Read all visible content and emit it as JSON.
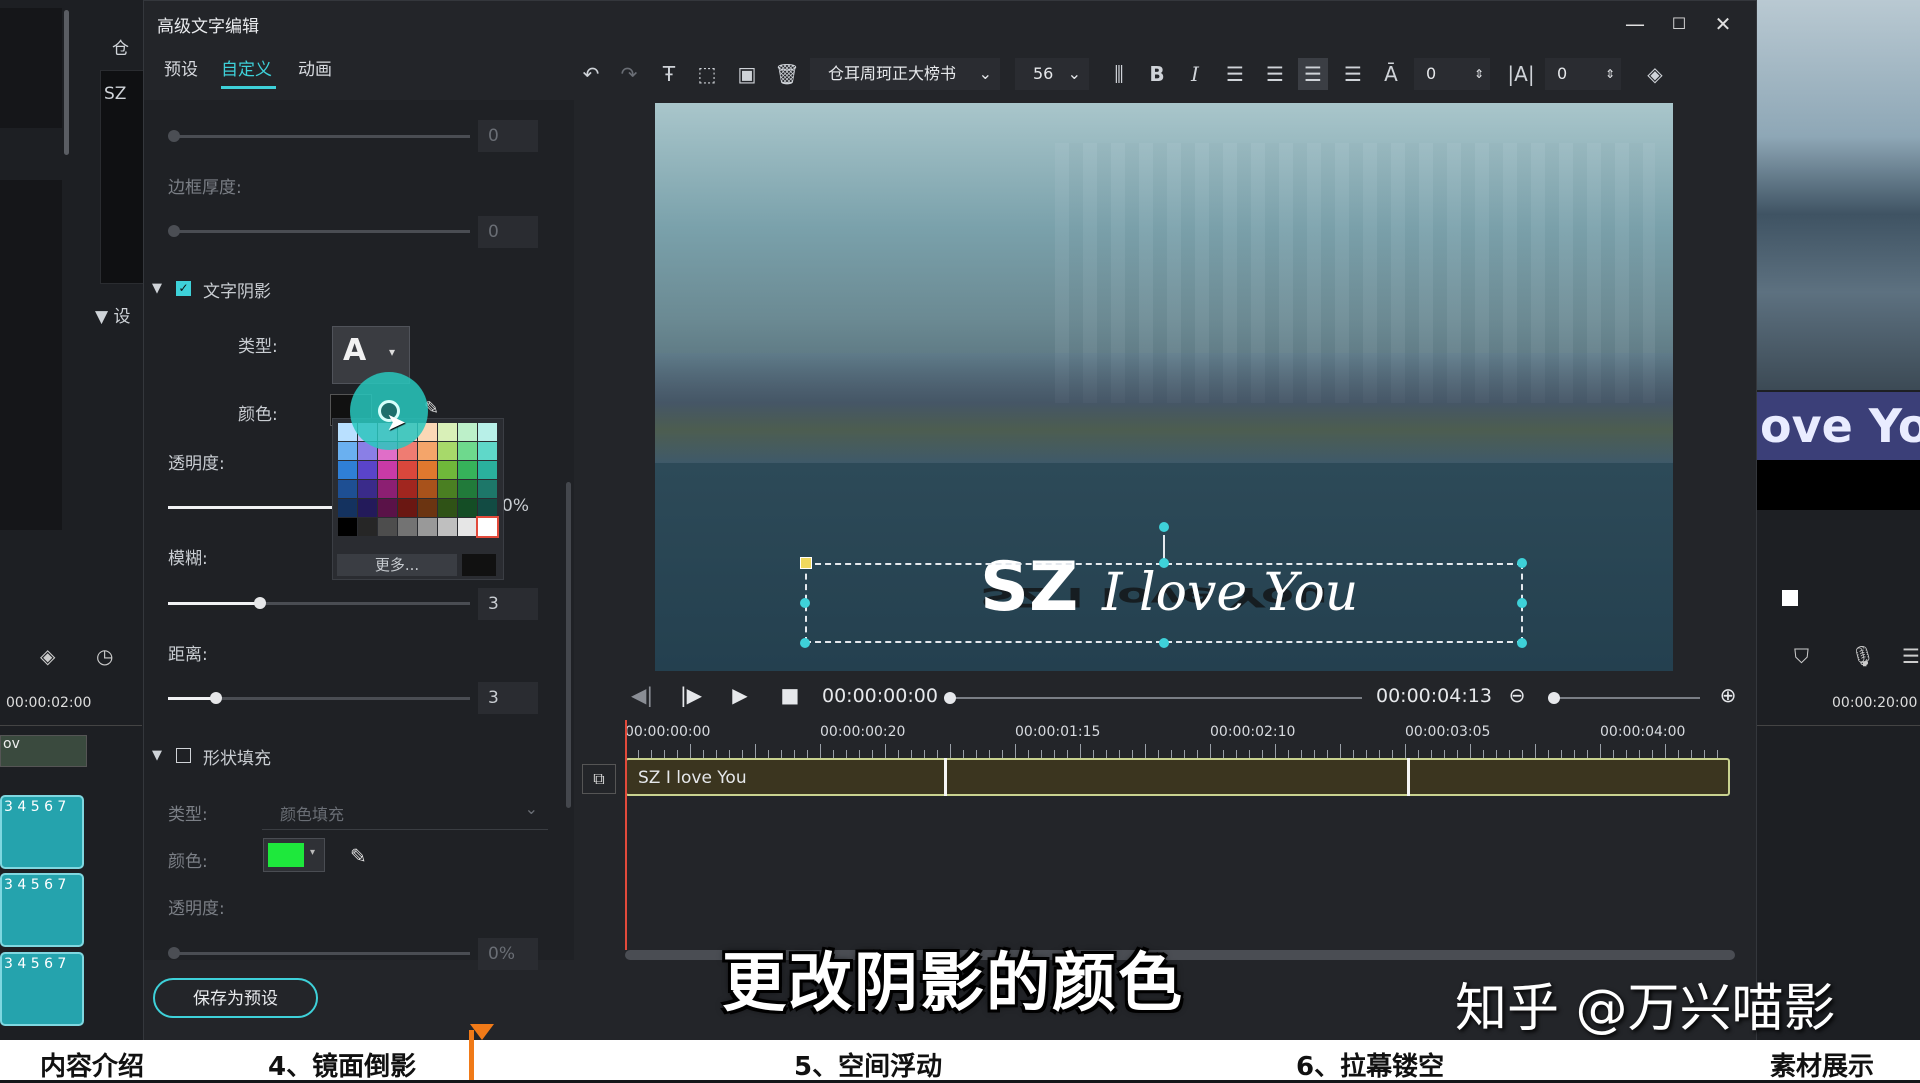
{
  "dialog": {
    "title": "高级文字编辑"
  },
  "window_controls": {
    "minimize": "—",
    "maximize": "☐",
    "close": "✕"
  },
  "tabs": [
    {
      "label": "预设"
    },
    {
      "label": "自定义",
      "active": true
    },
    {
      "label": "动画"
    }
  ],
  "toolbar": {
    "font": "仓耳周珂正大榜书",
    "size": "56",
    "spacing_value": "0",
    "line_spacing_value": "0",
    "icons": [
      "undo-icon",
      "redo-icon",
      "text-add-icon",
      "crop-icon",
      "image-icon",
      "delete-icon",
      "align-icon",
      "bold-icon",
      "italic-icon",
      "align-left-icon",
      "align-right-icon",
      "align-center-icon",
      "justify-icon",
      "text-spacing-icon",
      "line-spacing-icon",
      "layers-icon"
    ]
  },
  "left_panel": {
    "top_slider_value": "0",
    "border_thickness_label": "边框厚度:",
    "border_value": "0",
    "shadow_section": {
      "label": "文字阴影",
      "checked": true
    },
    "type_label": "类型:",
    "type_glyph": "A",
    "color_label": "颜色:",
    "opacity_label": "透明度:",
    "opacity_value_partial": "0%",
    "blur_label": "模糊:",
    "blur_value": "3",
    "blur_level": 0.3,
    "distance_label": "距离:",
    "distance_value": "3",
    "distance_level": 0.16,
    "palette_more": "更多...",
    "shape_fill_section": {
      "label": "形状填充",
      "checked": false
    },
    "fill_type_label": "类型:",
    "fill_type_value": "颜色填充",
    "fill_color_label": "颜色:",
    "fill_color": "#1ee83c",
    "fill_opacity_label": "透明度:",
    "fill_opacity_value": "0%",
    "save_preset": "保存为预设"
  },
  "preview": {
    "title_main": "SZ",
    "title_rest": "I love You"
  },
  "playback": {
    "current_time": "00:00:00:00",
    "duration": "00:00:04:13"
  },
  "timeline": {
    "ticks": [
      "00:00:00:00",
      "00:00:00:20",
      "00:00:01:15",
      "00:00:02:10",
      "00:00:03:05",
      "00:00:04:00"
    ],
    "clip_label": "SZ  I love You"
  },
  "background_editor": {
    "bin_items": [
      "仓",
      "SZ"
    ],
    "settings_label": "设",
    "ruler_left_time": "00:00:02:00",
    "ruler_right_time": "00:00:20:00",
    "track_numbers": "3 4 5 6 7",
    "preview_text": "ove Yo",
    "track_label_top": "ov"
  },
  "subtitle": "更改阴影的颜色",
  "watermark": "知乎 @万兴喵影",
  "chapters": [
    "内容介绍",
    "4、镜面倒影",
    "5、空间浮动",
    "6、拉幕镂空",
    "素材展示"
  ],
  "colors": {
    "accent": "#3ed1d9",
    "clip_border": "#c9d28f",
    "playhead": "#e24a3b",
    "chapter_marker": "#f07a18"
  }
}
